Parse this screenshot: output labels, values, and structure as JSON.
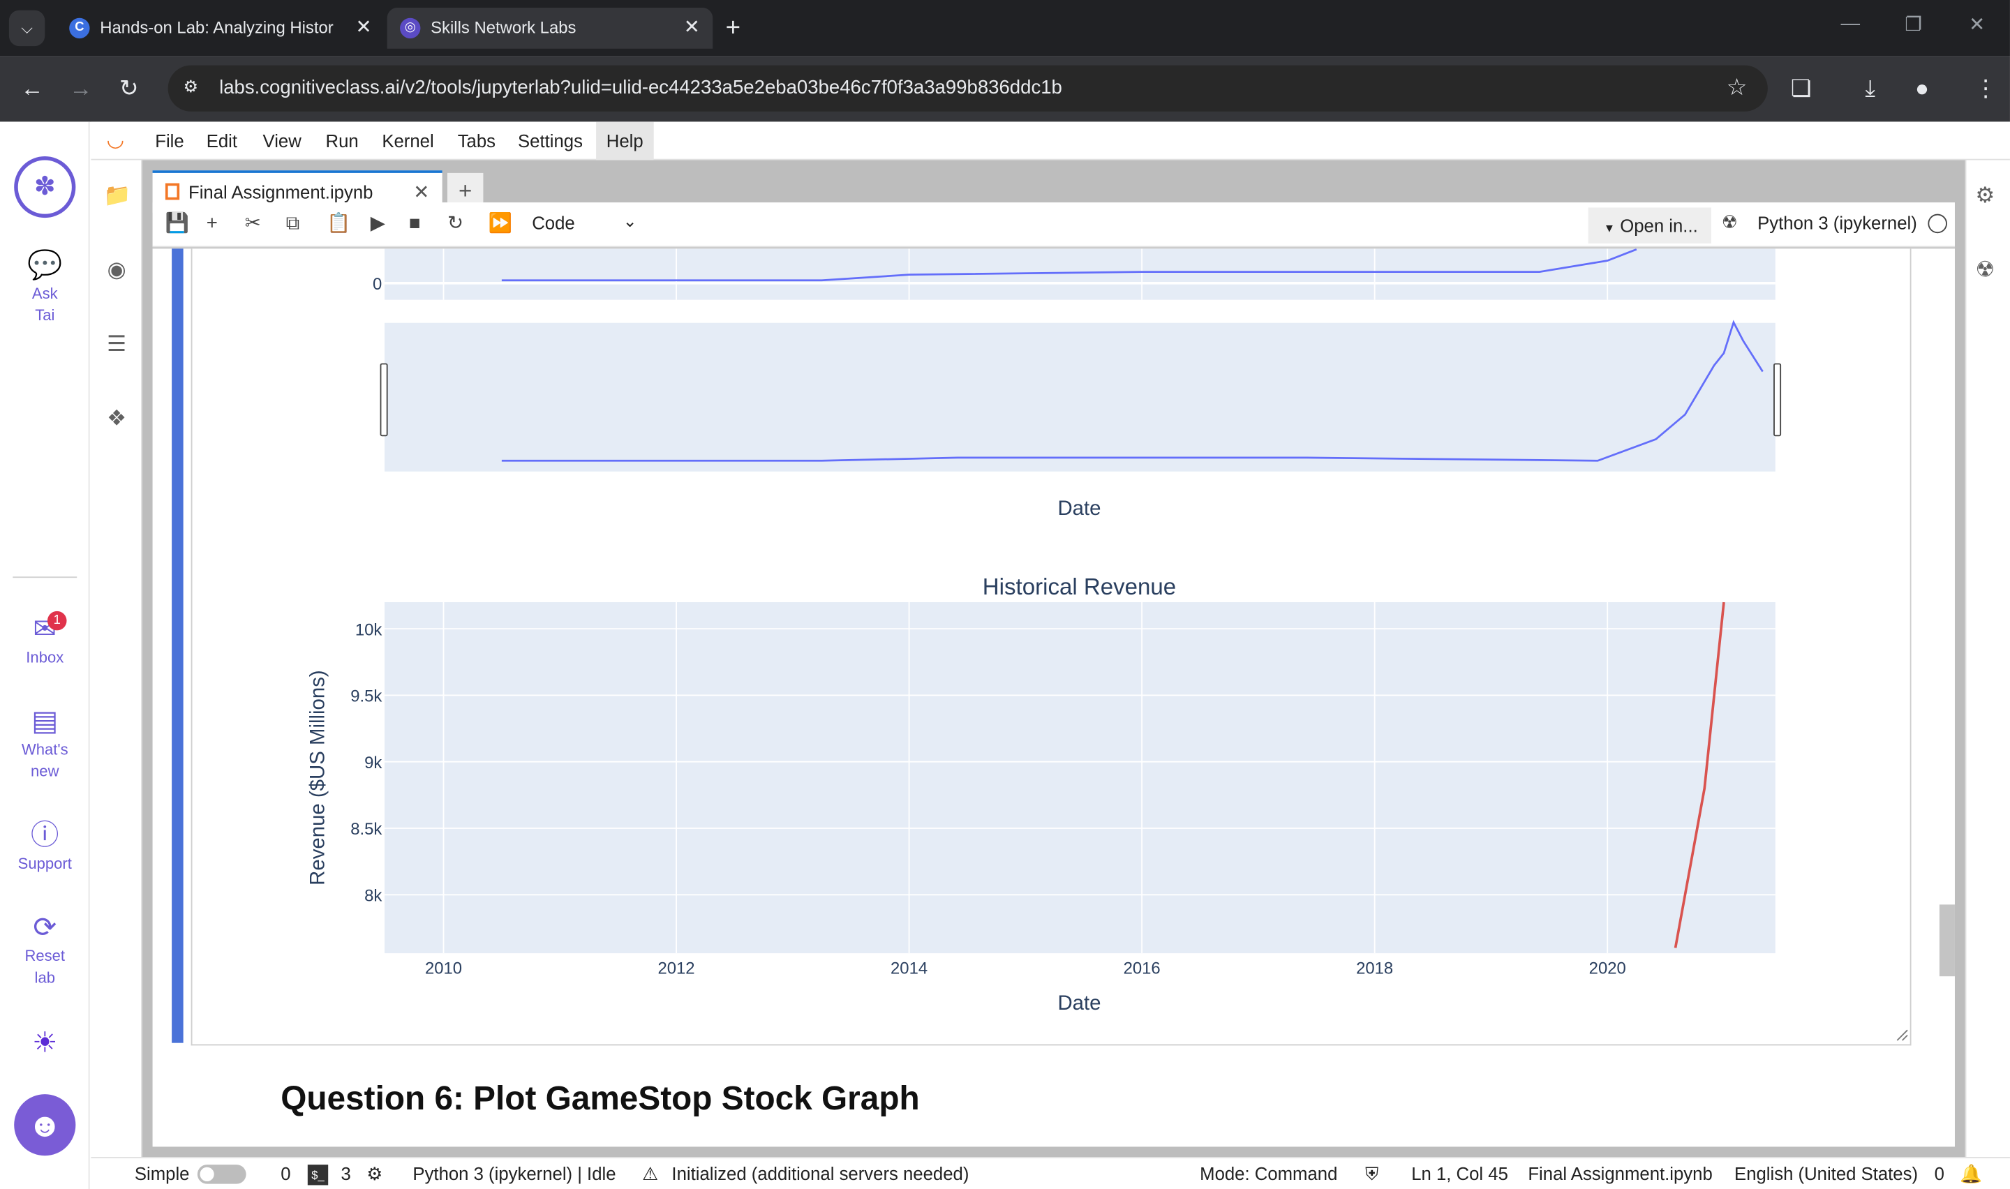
{
  "browser": {
    "tabs": [
      {
        "title": "Hands-on Lab: Analyzing Histor",
        "favicon": "C"
      },
      {
        "title": "Skills Network Labs",
        "favicon": "◎"
      }
    ],
    "url": "labs.cognitiveclass.ai/v2/tools/jupyterlab?ulid=ulid-ec44233a5e2eba03be46c7f0f3a3a99b836ddc1b"
  },
  "sn_sidebar": {
    "items": [
      {
        "label1": "Ask",
        "label2": "Tai",
        "icon": "chat-bubble-icon"
      },
      {
        "label1": "Inbox",
        "label2": "",
        "icon": "inbox-icon",
        "badge": "1"
      },
      {
        "label1": "What's",
        "label2": "new",
        "icon": "newspaper-icon"
      },
      {
        "label1": "Support",
        "label2": "",
        "icon": "help-icon"
      },
      {
        "label1": "Reset",
        "label2": "lab",
        "icon": "reset-icon"
      }
    ],
    "accent": "#6b5bd6"
  },
  "menu": [
    "File",
    "Edit",
    "View",
    "Run",
    "Kernel",
    "Tabs",
    "Settings",
    "Help"
  ],
  "notebook": {
    "tab_name": "Final Assignment.ipynb",
    "cell_type": "Code",
    "open_in": "Open in...",
    "kernel": "Python 3 (ipykernel)",
    "heading": "Question 6: Plot GameStop Stock Graph"
  },
  "chart_data": [
    {
      "type": "line",
      "title": "",
      "xlabel": "",
      "ylabel": "",
      "y_tick_labels": [
        "0"
      ],
      "x_tick_labels": [],
      "color": "#636efa",
      "note_visible": "partially visible top stock price panel",
      "x": [
        "2010-07",
        "2013-04",
        "2014-01",
        "2016-01",
        "2017-06",
        "2019-06",
        "2020-01",
        "2020-04"
      ],
      "series": [
        {
          "values": [
            1,
            1,
            3,
            4,
            4,
            4,
            8,
            12
          ]
        }
      ]
    },
    {
      "type": "area",
      "title": "",
      "xlabel": "Date",
      "color": "#636efa",
      "x": [
        "2010-07",
        "2013-04",
        "2014-06",
        "2017-06",
        "2019-12",
        "2020-06",
        "2020-09",
        "2020-12",
        "2021-01",
        "2021-02",
        "2021-03",
        "2021-05"
      ],
      "series": [
        {
          "values": [
            1,
            1,
            2,
            2,
            1,
            8,
            16,
            32,
            36,
            46,
            40,
            30
          ]
        }
      ]
    },
    {
      "type": "line",
      "title": "Historical Revenue",
      "xlabel": "Date",
      "ylabel": "Revenue ($US Millions)",
      "y_tick_labels": [
        "10k",
        "9.5k",
        "9k",
        "8.5k",
        "8k"
      ],
      "x_tick_labels": [
        "2010",
        "2012",
        "2014",
        "2016",
        "2018",
        "2020"
      ],
      "ylim": [
        7560,
        10200
      ],
      "color": "#d9534f",
      "x": [
        "2020-08",
        "2020-11",
        "2021-01"
      ],
      "series": [
        {
          "values": [
            7600,
            8800,
            10200
          ]
        }
      ]
    }
  ],
  "statusbar": {
    "mode_label": "Simple",
    "count0": "0",
    "terminals": "3",
    "kernel_status": "Python 3 (ipykernel) | Idle",
    "init": "Initialized (additional servers needed)",
    "mode": "Mode: Command",
    "position": "Ln 1, Col 45",
    "file": "Final Assignment.ipynb",
    "language": "English (United States)",
    "notifications": "0"
  }
}
